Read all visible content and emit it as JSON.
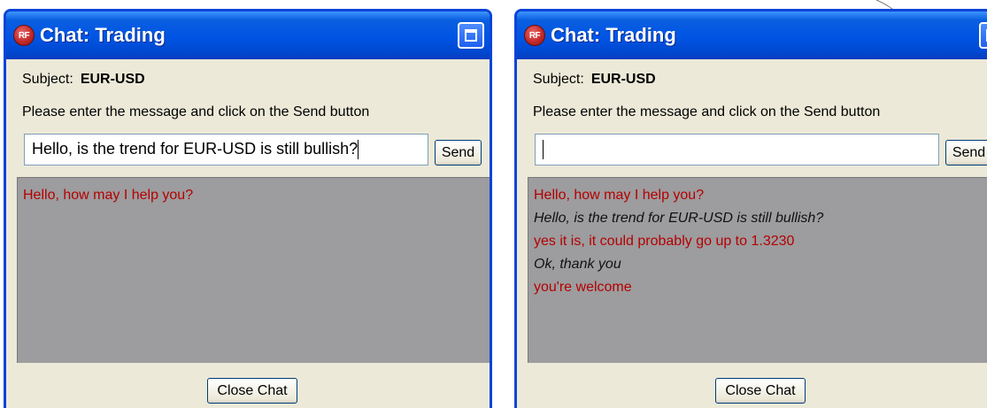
{
  "windows": [
    {
      "title": "Chat: Trading",
      "logo_text": "RF",
      "subject_label": "Subject:",
      "subject_value": "EUR-USD",
      "instruction": "Please enter the message and click on the Send button",
      "input_value": "Hello, is the trend for  EUR-USD is still bullish?",
      "send_label": "Send",
      "messages": [
        {
          "sender": "agent",
          "text": "Hello, how may I help you?"
        }
      ],
      "close_label": "Close Chat"
    },
    {
      "title": "Chat: Trading",
      "logo_text": "RF",
      "subject_label": "Subject:",
      "subject_value": "EUR-USD",
      "instruction": "Please enter the message and click on the Send button",
      "input_value": "",
      "send_label": "Send",
      "messages": [
        {
          "sender": "agent",
          "text": "Hello, how may I help you?"
        },
        {
          "sender": "user",
          "text": "Hello, is the trend for  EUR-USD is still bullish?"
        },
        {
          "sender": "agent",
          "text": "yes it is, it could probably go up to 1.3230"
        },
        {
          "sender": "user",
          "text": "Ok, thank you"
        },
        {
          "sender": "agent",
          "text": "you're welcome"
        }
      ],
      "close_label": "Close Chat"
    }
  ],
  "colors": {
    "titlebar": "#0054e3",
    "window_bg": "#ece9d8",
    "chat_bg": "#9d9c9e",
    "agent_text": "#b40000",
    "user_text": "#111111"
  },
  "icons": {
    "maximize": "maximize-icon",
    "logo": "app-logo-icon"
  }
}
